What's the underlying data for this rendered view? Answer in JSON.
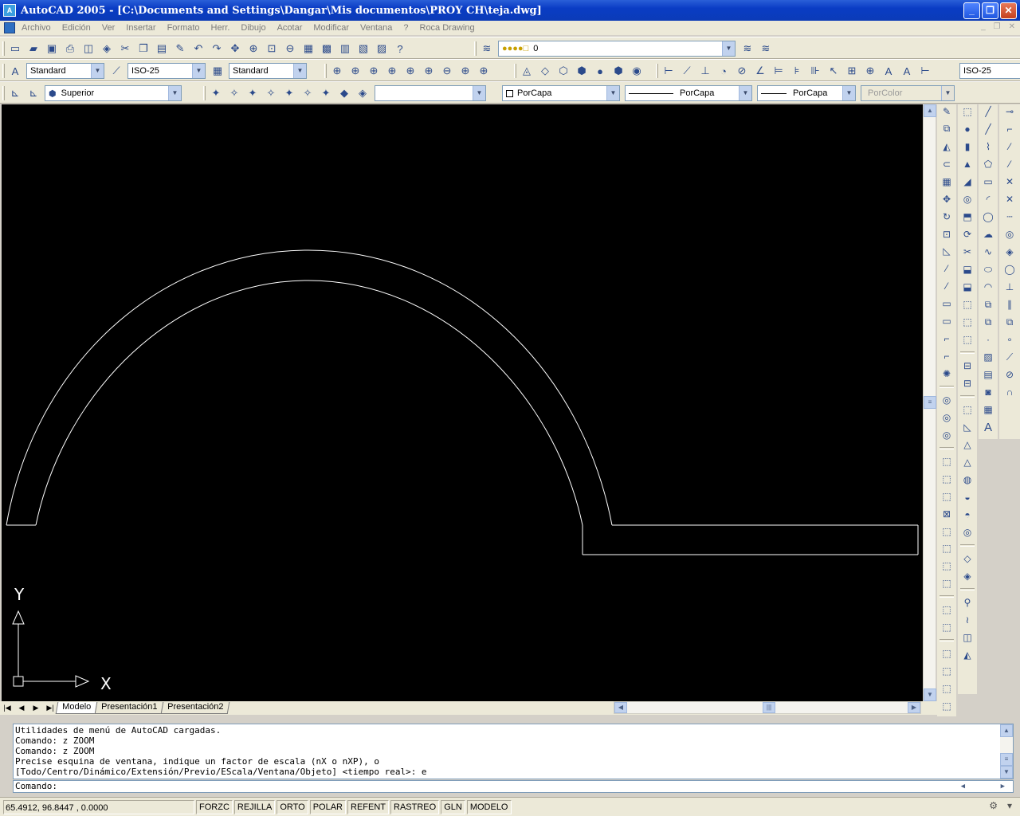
{
  "window": {
    "title": "AutoCAD 2005 - [C:\\Documents and Settings\\Dangar\\Mis documentos\\PROY CH\\teja.dwg]",
    "app_icon": "acad-icon",
    "buttons": {
      "minimize": "_",
      "restore": "❐",
      "close": "✕"
    }
  },
  "menu": {
    "items": [
      "Archivo",
      "Edición",
      "Ver",
      "Insertar",
      "Formato",
      "Herr.",
      "Dibujo",
      "Acotar",
      "Modificar",
      "Ventana",
      "?",
      "Roca Drawing"
    ],
    "mdi_buttons": [
      "_",
      "❐",
      "✕"
    ]
  },
  "toolbar1": {
    "layer_value": "0"
  },
  "toolbar2": {
    "text_style": "Standard",
    "dim_style": "ISO-25",
    "table_style": "Standard",
    "dim_style_right": "ISO-25"
  },
  "toolbar3": {
    "view": "Superior",
    "empty_combo": "",
    "color": "PorCapa",
    "linetype": "PorCapa",
    "lineweight": "PorCapa",
    "plotstyle": "PorColor"
  },
  "ucs": {
    "x_label": "X",
    "y_label": "Y"
  },
  "tabs": [
    "Modelo",
    "Presentación1",
    "Presentación2"
  ],
  "command": {
    "history": [
      "Utilidades de menú de AutoCAD cargadas.",
      "Comando: z ZOOM",
      "Comando: z ZOOM",
      "Precise esquina de ventana, indique un factor de escala (nX o nXP), o",
      "[Todo/Centro/Dinámico/Extensión/Previo/EScala/Ventana/Objeto] <tiempo real>: e"
    ],
    "prompt": "Comando:"
  },
  "status": {
    "coords": "65.4912, 96.8447 , 0.0000",
    "toggles": [
      "FORZC",
      "REJILLA",
      "ORTO",
      "POLAR",
      "REFENT",
      "RASTREO",
      "GLN",
      "MODELO"
    ]
  },
  "colors": {
    "canvas": "#000000",
    "geometry": "#ffffff",
    "titlebar": "#0a3cc4"
  }
}
